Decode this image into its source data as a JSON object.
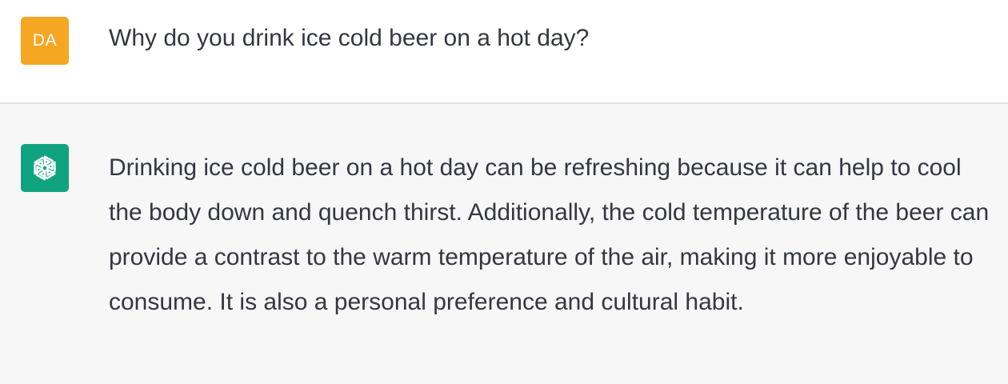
{
  "user": {
    "avatar_initials": "DA",
    "avatar_color": "#f5a623",
    "message": "Why do you drink ice cold beer on a hot day?"
  },
  "assistant": {
    "avatar_icon": "openai-logo-icon",
    "avatar_color": "#10a37f",
    "message": "Drinking ice cold beer on a hot day can be refreshing because it can help to cool the body down and quench thirst. Additionally, the cold temperature of the beer can provide a contrast to the warm temperature of the air, making it more enjoyable to consume. It is also a personal preference and cultural habit."
  }
}
